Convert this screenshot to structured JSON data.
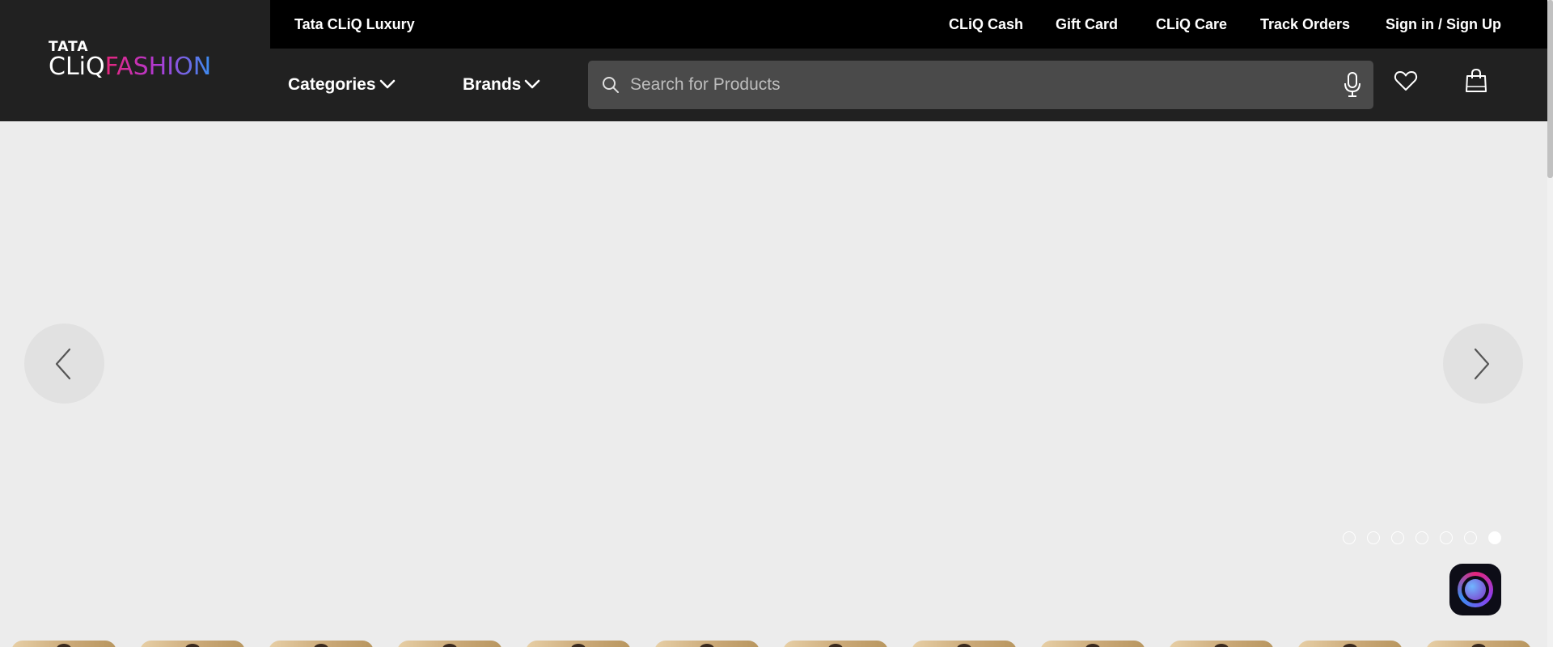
{
  "logo": {
    "tata": "TATA",
    "cliq": "CLiQ",
    "fashion": "FASHION"
  },
  "topbar": {
    "luxury": "Tata CLiQ Luxury",
    "links": [
      "CLiQ Cash",
      "Gift Card",
      "CLiQ Care",
      "Track Orders",
      "Sign in / Sign Up"
    ]
  },
  "nav": {
    "categories": "Categories",
    "brands": "Brands"
  },
  "search": {
    "placeholder": "Search for Products",
    "value": ""
  },
  "carousel": {
    "slide_count": 7,
    "active_index": 6
  },
  "category_strip": {
    "visible_tiles": 12
  },
  "colors": {
    "header_bg": "#212121",
    "topbar_bg": "#000000",
    "page_bg": "#ececec",
    "search_bg": "#4a4a4a",
    "brand_pink": "#e6257a",
    "brand_blue": "#3a8df0"
  },
  "icons": {
    "search": "search-icon",
    "mic": "microphone-icon",
    "wishlist": "heart-icon",
    "bag": "shopping-bag-icon",
    "prev": "chevron-left-icon",
    "next": "chevron-right-icon",
    "dropdown": "chevron-down-icon",
    "assistant": "ai-assistant-icon"
  }
}
